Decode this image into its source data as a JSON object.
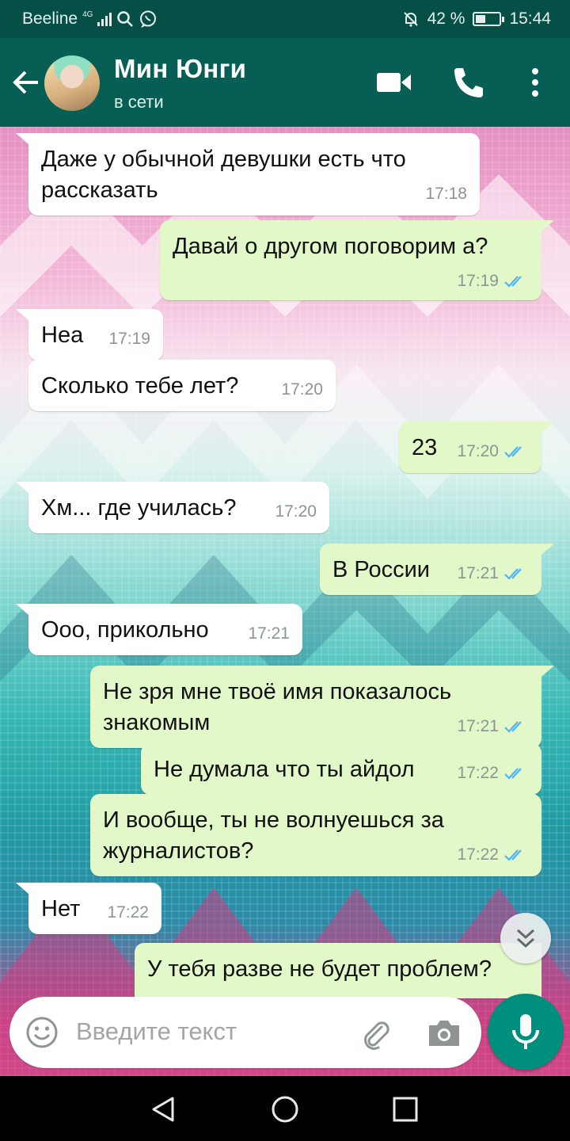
{
  "status_bar": {
    "carrier": "Beeline",
    "network": "4G",
    "battery": "42 %",
    "battery_level": 0.42,
    "time": "15:44"
  },
  "header": {
    "contact_name": "Мин Юнги",
    "contact_status": "в сети",
    "icons": [
      "back-arrow-icon",
      "video-call-icon",
      "phone-call-icon",
      "more-options-icon"
    ]
  },
  "messages": [
    {
      "dir": "in",
      "text": "Даже у обычной девушки есть что рассказать",
      "time": "17:18"
    },
    {
      "dir": "out",
      "text": "Давай о другом поговорим а?",
      "time": "17:19",
      "read": true
    },
    {
      "dir": "in",
      "text": "Неа",
      "time": "17:19"
    },
    {
      "dir": "in",
      "text": "Сколько тебе лет?",
      "time": "17:20"
    },
    {
      "dir": "out",
      "text": "23",
      "time": "17:20",
      "read": true
    },
    {
      "dir": "in",
      "text": "Хм... где училась?",
      "time": "17:20"
    },
    {
      "dir": "out",
      "text": "В России",
      "time": "17:21",
      "read": true
    },
    {
      "dir": "in",
      "text": "Ооо, прикольно",
      "time": "17:21"
    },
    {
      "dir": "out",
      "text": "Не зря мне твоё имя показалось знакомым",
      "time": "17:21",
      "read": true
    },
    {
      "dir": "out",
      "text": "Не думала что ты айдол",
      "time": "17:22",
      "read": true
    },
    {
      "dir": "out",
      "text": "И вообще, ты не волнуешься за журналистов?",
      "time": "17:22",
      "read": true
    },
    {
      "dir": "in",
      "text": "Нет",
      "time": "17:22"
    },
    {
      "dir": "out",
      "text": "У тебя разве не будет проблем?",
      "time": ""
    }
  ],
  "input": {
    "placeholder": "Введите текст"
  },
  "colors": {
    "header": "#075e54",
    "outgoing_bubble": "#e2f8c9",
    "incoming_bubble": "#ffffff",
    "read_ticks": "#4fb3f6",
    "mic_button": "#008f7d"
  }
}
